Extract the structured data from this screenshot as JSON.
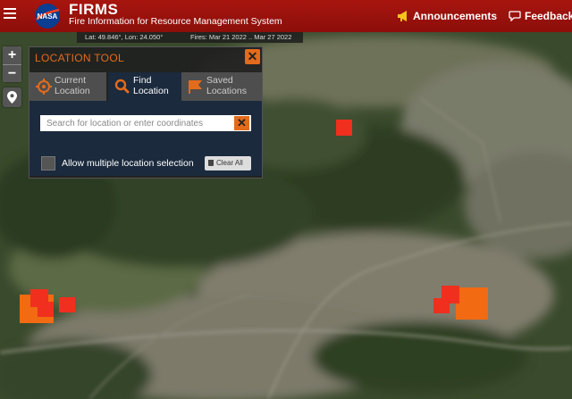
{
  "header": {
    "logo_text": "NASA",
    "title": "FIRMS",
    "subtitle": "Fire Information for Resource Management System",
    "announcements_label": "Announcements",
    "feedback_label": "Feedback",
    "menu_icon": "hamburger-icon",
    "announcements_icon": "megaphone-icon",
    "feedback_icon": "chat-bubble-icon",
    "bar_color": "#9c120c",
    "accent_color": "#f6c31b"
  },
  "infobar": {
    "coordinates": "Lat: 49.846°, Lon: 24.050°",
    "fires_range": "Fires: Mar 21 2022 .. Mar 27 2022"
  },
  "map_controls": {
    "zoom_in": "+",
    "zoom_out": "−",
    "locate_icon": "map-pin-icon"
  },
  "location_tool": {
    "title": "LOCATION TOOL",
    "close_icon": "close-icon",
    "accent_color": "#e36b1c",
    "tabs": [
      {
        "label_line1": "Current",
        "label_line2": "Location",
        "icon": "crosshair-icon",
        "active": false
      },
      {
        "label_line1": "Find",
        "label_line2": "Location",
        "icon": "magnifier-icon",
        "active": true
      },
      {
        "label_line1": "Saved",
        "label_line2": "Locations",
        "icon": "flag-icon",
        "active": false
      }
    ],
    "search": {
      "value": "",
      "placeholder": "Search for location or enter coordinates",
      "clear_icon": "close-icon"
    },
    "multi_select": {
      "label": "Allow multiple location selection",
      "checked": false
    },
    "clear_all_label": "Clear All",
    "clear_all_icon": "trash-icon"
  },
  "fire_colors": {
    "recent": "#f02f1e",
    "older": "#f26a12"
  }
}
